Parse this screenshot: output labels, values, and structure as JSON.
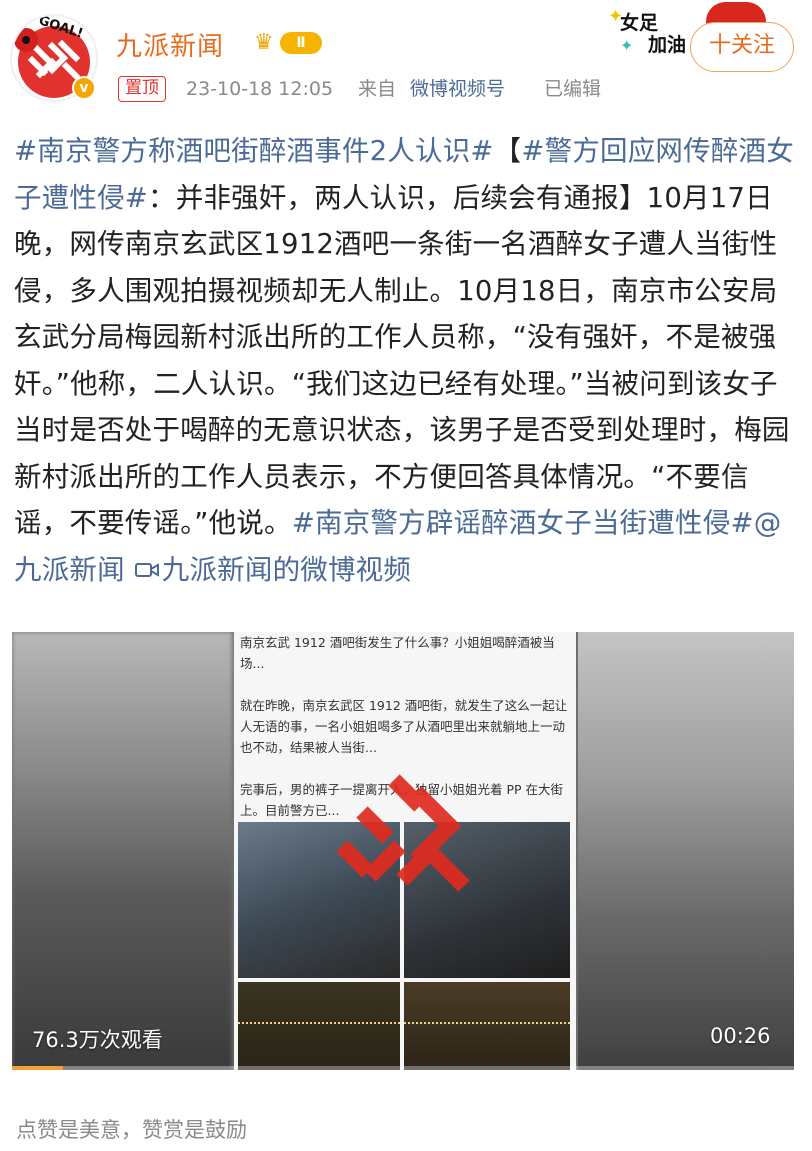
{
  "header": {
    "account_name": "九派新闻",
    "avatar_label": "GOAL!",
    "verified_mark": "v",
    "level": "Ⅱ",
    "pinned_tag": "置顶",
    "post_time": "23-10-18 12:05",
    "source_prefix": "来自",
    "source_name": "微博视频号",
    "edited": "已编辑",
    "follow_label": "十关注",
    "sticker_text_1": "女足",
    "sticker_text_2": "加油"
  },
  "post": {
    "tag_1": "#南京警方称酒吧街醉酒事件2人认识#",
    "bracket_open": "【",
    "tag_2": "#警方回应网传醉酒女子遭性侵#",
    "body": "：并非强奸，两人认识，后续会有通报】10月17日晚，网传南京玄武区1912酒吧一条街一名酒醉女子遭人当街性侵，多人围观拍摄视频却无人制止。10月18日，南京市公安局玄武分局梅园新村派出所的工作人员称，“没有强奸，不是被强奸。”他称，二人认识。“我们这边已经有处理。”当被问到该女子当时是否处于喝醉的无意识状态，该男子是否受到处理时，梅园新村派出所的工作人员表示，不方便回答具体情况。“不要信谣，不要传谣。”他说。",
    "tag_3": "#南京警方辟谣醉酒女子当街遭性侵#",
    "mention": "@九派新闻",
    "video_link": "九派新闻的微博视频"
  },
  "video": {
    "screenshot_line_1": "南京玄武 1912 酒吧街发生了什么事？小姐姐喝醉酒被当场...",
    "screenshot_line_2": "就在昨晚，南京玄武区 1912 酒吧街，就发生了这么一起让人无语的事，一名小姐姐喝多了从酒吧里出来就躺地上一动也不动，结果被人当街...",
    "screenshot_line_3": "完事后，男的裤子一提离开人，独留小姐姐光着 PP 在大街上。目前警方已...",
    "view_count": "76.3万次观看",
    "duration": "00:26",
    "progress": 0.065
  },
  "footer": {
    "reward_text": "点赞是美意，赞赏是鼓励"
  },
  "colors": {
    "accent_orange": "#e86b1e",
    "link_blue": "#4b6b96",
    "pinned_red": "#e5322d",
    "progress": "#f2a13a"
  }
}
